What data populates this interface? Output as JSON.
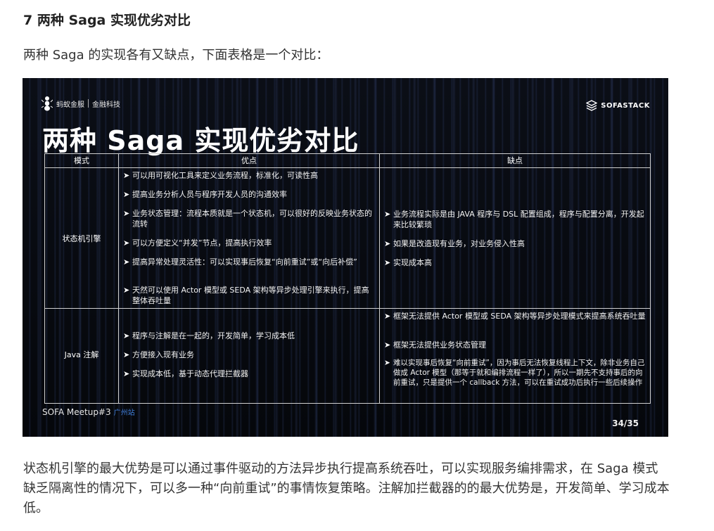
{
  "article": {
    "heading": "7 两种 Saga 实现优劣对比",
    "intro": "两种 Saga 的实现各有又缺点，下面表格是一个对比：",
    "summary": "状态机引擎的最大优势是可以通过事件驱动的方法异步执行提高系统吞吐，可以实现服务编排需求，在 Saga 模式缺乏隔离性的情况下，可以多一种“向前重试”的事情恢复策略。注解加拦截器的的最大优势是，开发简单、学习成本低。"
  },
  "slide": {
    "logo_left_brand": "蚂蚁金服",
    "logo_left_sub": "金融科技",
    "logo_right": "SOFASTACK",
    "title": "两种 Saga 实现优劣对比",
    "footer": "SOFA Meetup#3",
    "footer_city": "广州站",
    "page": "34/35",
    "table": {
      "headers": [
        "模式",
        "优点",
        "缺点"
      ],
      "rows": [
        {
          "mode": "状态机引擎",
          "pros": [
            "可以用可视化工具来定义业务流程，标准化，可读性高",
            "提高业务分析人员与程序开发人员的沟通效率",
            "业务状态管理：流程本质就是一个状态机，可以很好的反映业务状态的流转",
            "可以方便定义“并发”节点，提高执行效率",
            "提高异常处理灵活性：可以实现事后恢复“向前重试”或“向后补偿”",
            "天然可以使用 Actor 模型或 SEDA 架构等异步处理引擎来执行，提高整体吞吐量"
          ],
          "cons": [
            "业务流程实际是由 JAVA 程序与 DSL 配置组成，程序与配置分离，开发起来比较繁琐",
            "如果是改造现有业务，对业务侵入性高",
            "实现成本高"
          ]
        },
        {
          "mode": "Java 注解",
          "pros": [
            "程序与注解是在一起的，开发简单，学习成本低",
            "方便接入现有业务",
            "实现成本低，基于动态代理拦截器"
          ],
          "cons": [
            "框架无法提供 Actor 模型或 SEDA 架构等异步处理模式来提高系统吞吐量",
            "框架无法提供业务状态管理",
            "难以实现事后恢复“向前重试”，因为事后无法恢复线程上下文，除非业务自己做成 Actor 模型（那等于就和编排流程一样了），所以一期先不支持事后的向前重试，只是提供一个 callback 方法，可以在重试成功后执行一些后续操作"
          ]
        }
      ]
    }
  }
}
